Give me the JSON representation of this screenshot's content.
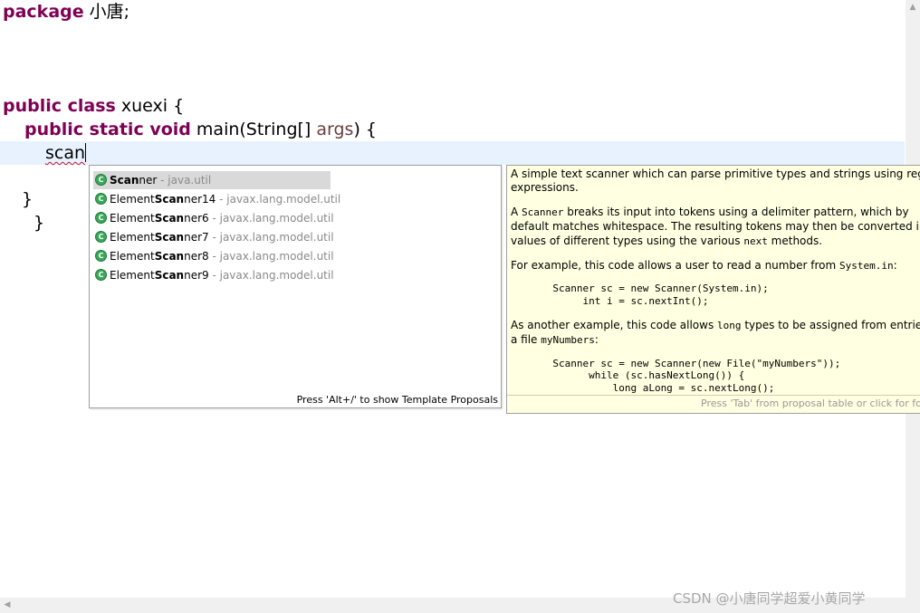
{
  "editor": {
    "line1_keyword": "package",
    "line1_rest": " 小唐;",
    "line2_keywords": "public class",
    "line2_rest": " xuexi {",
    "line3_keywords": "public static void",
    "line3_mid": " main(String[] ",
    "line3_param": "args",
    "line3_end": ") {",
    "typed_text": "scan",
    "close_brace_inner": "}",
    "close_brace_outer": "}"
  },
  "proposals": {
    "items": [
      {
        "bold": "Scan",
        "rest": "ner",
        "pkg": " - java.util",
        "selected": true
      },
      {
        "pre": "Element",
        "bold": "Scan",
        "rest": "ner14",
        "pkg": " - javax.lang.model.util"
      },
      {
        "pre": "Element",
        "bold": "Scan",
        "rest": "ner6",
        "pkg": " - javax.lang.model.util"
      },
      {
        "pre": "Element",
        "bold": "Scan",
        "rest": "ner7",
        "pkg": " - javax.lang.model.util"
      },
      {
        "pre": "Element",
        "bold": "Scan",
        "rest": "ner8",
        "pkg": " - javax.lang.model.util"
      },
      {
        "pre": "Element",
        "bold": "Scan",
        "rest": "ner9",
        "pkg": " - javax.lang.model.util"
      }
    ],
    "icon": "class-icon",
    "icon_glyph": "C",
    "footer": "Press 'Alt+/' to show Template Proposals"
  },
  "javadoc": {
    "p1_line1": "A simple text scanner which can parse primitive types and strings using regular",
    "p1_line2": "expressions.",
    "p2_line1_a": "A ",
    "p2_line1_code": "Scanner",
    "p2_line1_b": " breaks its input into tokens using a delimiter pattern, which by",
    "p2_line2": "default matches whitespace. The resulting tokens may then be converted into",
    "p2_line3_a": "values of different types using the various ",
    "p2_line3_code": "next",
    "p2_line3_b": " methods.",
    "p3_a": "For example, this code allows a user to read a number from ",
    "p3_code": "System.in",
    "p3_b": ":",
    "code1_line1": "       Scanner sc = new Scanner(System.in);",
    "code1_line2": "            int i = sc.nextInt();",
    "p4_line1_a": "As another example, this code allows ",
    "p4_line1_code": "long",
    "p4_line1_b": " types to be assigned from entries in",
    "p4_line2_a": "a file ",
    "p4_line2_code": "myNumbers",
    "p4_line2_b": ":",
    "code2_line1": "       Scanner sc = new Scanner(new File(\"myNumbers\"));",
    "code2_line2": "             while (sc.hasNextLong()) {",
    "code2_line3": "                 long aLong = sc.nextLong();",
    "footer": "Press 'Tab' from proposal table or click for focus"
  },
  "watermark": "CSDN @小唐同学超爱小黄同学",
  "colors": {
    "keyword": "#7f0055",
    "parameter": "#6a3e3e",
    "current_line": "#e8f2fe",
    "javadoc_bg": "#ffffe1",
    "class_icon": "#3aa858"
  }
}
